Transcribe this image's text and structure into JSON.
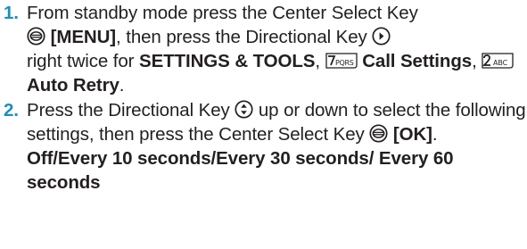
{
  "steps": [
    {
      "number": "1.",
      "pre_center": "From standby mode press the Center Select Key",
      "menu_label": "[MENU]",
      "then_dir": ", then press the Directional Key",
      "right_twice": "right twice for",
      "settings_tools": "SETTINGS & TOOLS",
      "key7_label": "7PQRS",
      "call_settings": "Call Settings",
      "key2_label": "2ABC",
      "auto_retry": "Auto Retry"
    },
    {
      "number": "2.",
      "pre_dir": "Press the Directional Key",
      "up_down": "up or down to select the following settings, then press the Center Select Key",
      "ok_label": "[OK]",
      "options": "Off/Every 10 seconds/Every 30 seconds/ Every 60 seconds"
    }
  ],
  "icons": {
    "center_select": "center-select-key-icon",
    "directional_right": "directional-right-icon",
    "directional_updown": "directional-up-down-icon",
    "key_7": "key-7-pqrs-icon",
    "key_2": "key-2-abc-icon"
  },
  "colors": {
    "step_number": "#1a8fc1",
    "text": "#231f20"
  }
}
